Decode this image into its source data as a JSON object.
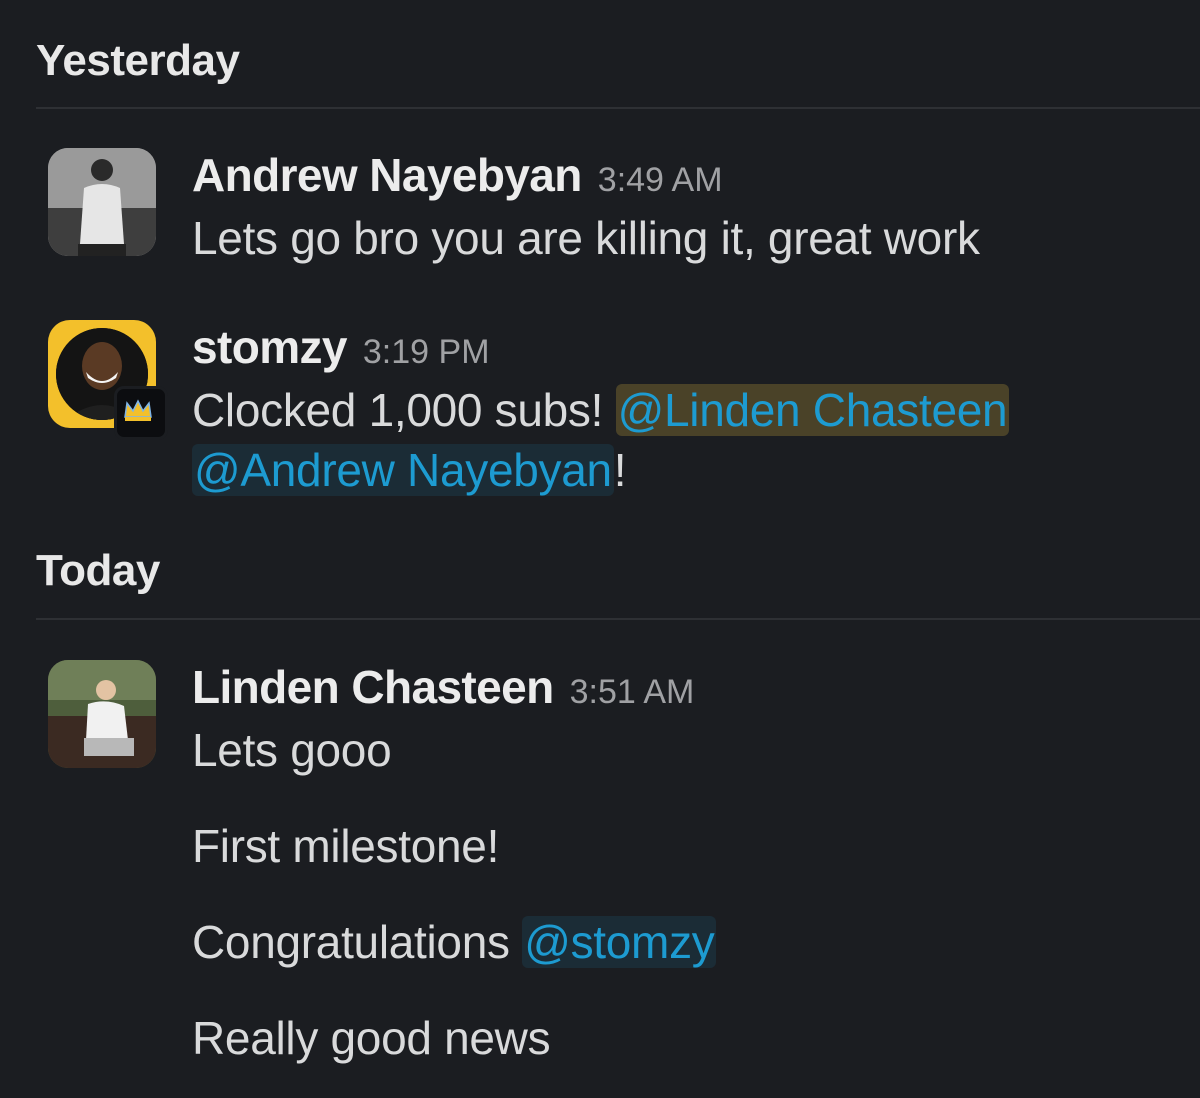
{
  "days": [
    {
      "label": "Yesterday"
    },
    {
      "label": "Today"
    }
  ],
  "messages": [
    {
      "author": "Andrew Nayebyan",
      "time": "3:49 AM",
      "text": "Lets go bro you are killing it, great work"
    },
    {
      "author": "stomzy",
      "time": "3:19 PM",
      "text_prefix": "Clocked 1,000 subs! ",
      "mention_1": "@Linden Chasteen",
      "mention_2": "@Andrew Nayebyan",
      "text_suffix": "!"
    },
    {
      "author": "Linden Chasteen",
      "time": "3:51 AM",
      "para_1": "Lets gooo",
      "para_2": "First milestone!",
      "para_3_prefix": "Congratulations ",
      "para_3_mention": "@stomzy",
      "para_4": "Really good news"
    }
  ],
  "colors": {
    "background": "#1b1d21",
    "mention": "#1d9bd1",
    "avatar_yellow": "#f3c02b"
  }
}
